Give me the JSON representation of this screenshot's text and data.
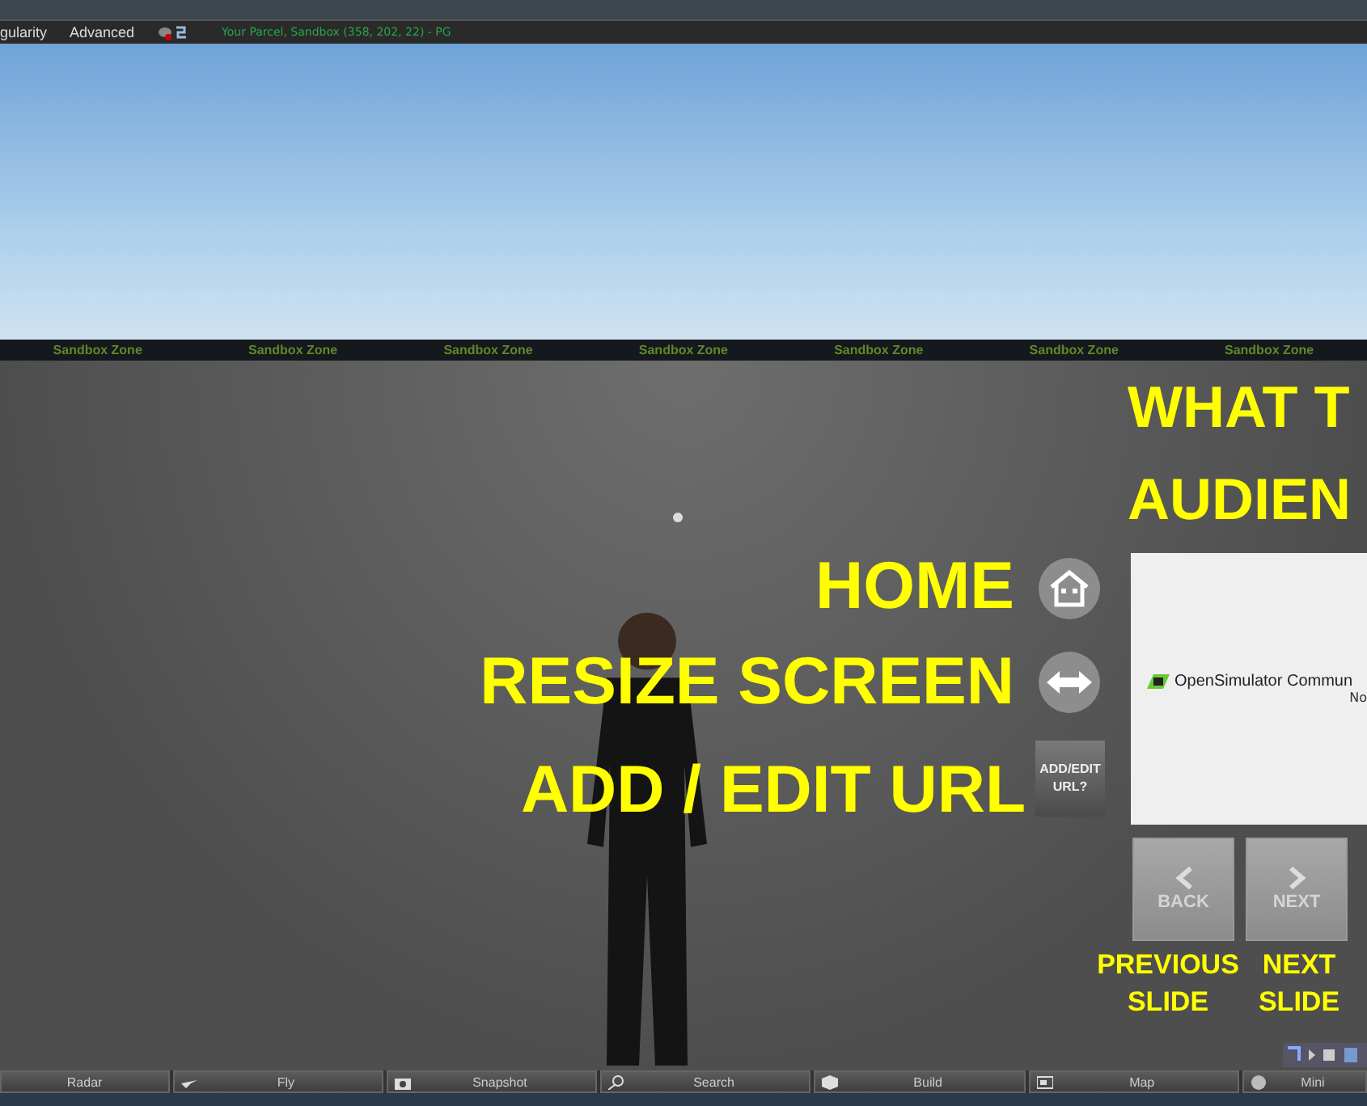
{
  "menu_bar": {
    "items": [
      "gularity",
      "Advanced"
    ],
    "status": "Your Parcel, Sandbox (358, 202, 22) - PG"
  },
  "banner": {
    "labels": [
      "Sandbox Zone",
      "Sandbox Zone",
      "Sandbox Zone",
      "Sandbox Zone",
      "Sandbox Zone",
      "Sandbox Zone",
      "Sandbox Zone"
    ]
  },
  "heading_lines": [
    "WHAT T",
    "AUDIEN"
  ],
  "callouts": [
    {
      "kind": "home",
      "label": "HOME"
    },
    {
      "kind": "resize",
      "label": "RESIZE SCREEN"
    },
    {
      "kind": "url",
      "label": "ADD / EDIT URL",
      "button_label": "ADD/EDIT URL?"
    }
  ],
  "slide": {
    "title": "OpenSimulator Commun",
    "subtitle": "No"
  },
  "nav_buttons": [
    {
      "kind": "back",
      "label": "BACK",
      "caption": "PREVIOUS SLIDE"
    },
    {
      "kind": "next",
      "label": "NEXT",
      "caption": "NEXT SLIDE"
    }
  ],
  "toolbar": [
    {
      "label": "Radar",
      "kind": "radar"
    },
    {
      "label": "Fly",
      "kind": "fly"
    },
    {
      "label": "Snapshot",
      "kind": "snapshot"
    },
    {
      "label": "Search",
      "kind": "search"
    },
    {
      "label": "Build",
      "kind": "build"
    },
    {
      "label": "Map",
      "kind": "map"
    },
    {
      "label": "Mini",
      "kind": "minimap"
    }
  ]
}
